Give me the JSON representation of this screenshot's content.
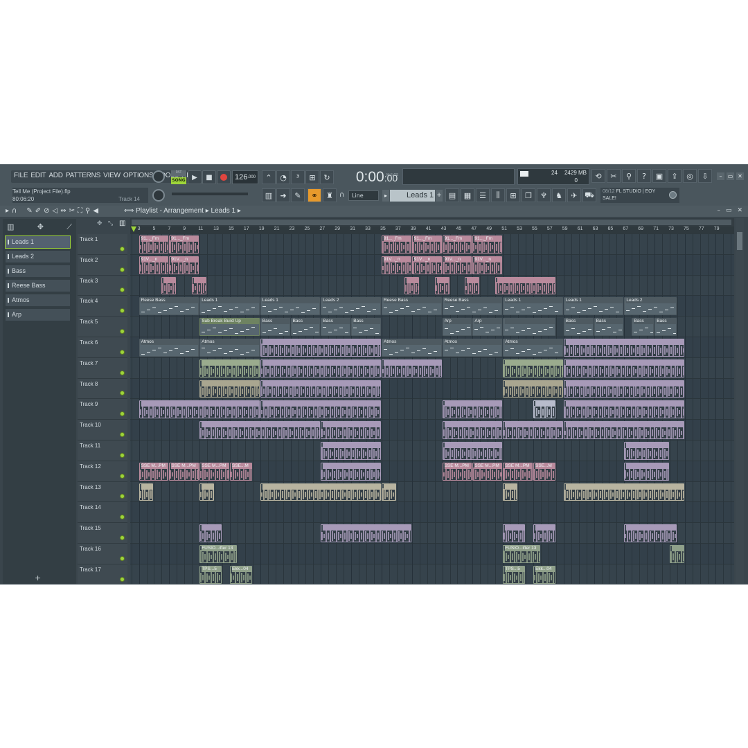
{
  "menu": [
    "FILE",
    "EDIT",
    "ADD",
    "PATTERNS",
    "VIEW",
    "OPTIONS",
    "TOOLS",
    "HELP"
  ],
  "transport": {
    "pat_label": "PAT",
    "song_label": "SONG",
    "tempo": "126",
    "tempo_decimals": ".000",
    "time": "0:00",
    "time_sub": "00",
    "time_unit": "M:S:CS"
  },
  "project": {
    "name": "Tell Me (Project File).flp",
    "time": "80:06:20",
    "track_hint": "Track 14"
  },
  "monitor": {
    "cpu": "24",
    "memory": "2429 MB",
    "polyphony": "0"
  },
  "pattern_selector": "Leads 1",
  "snap": "Line",
  "news": {
    "date": "08/12",
    "text": "FL STUDIO | EOY",
    "text2": "SALE!"
  },
  "playlist": {
    "breadcrumb": "Playlist - Arrangement",
    "pattern": "Leads 1"
  },
  "picker": {
    "items": [
      {
        "label": "Leads 1",
        "selected": true
      },
      {
        "label": "Leads 2"
      },
      {
        "label": "Bass"
      },
      {
        "label": "Reese Bass"
      },
      {
        "label": "Atmos"
      },
      {
        "label": "Arp"
      }
    ],
    "add_label": "+"
  },
  "ruler": {
    "labels": [
      "3",
      "5",
      "7",
      "9",
      "11",
      "13",
      "15",
      "17",
      "19",
      "21",
      "23",
      "25",
      "27",
      "29",
      "31",
      "33",
      "35",
      "37",
      "39",
      "41",
      "43",
      "45",
      "47",
      "49",
      "51",
      "53",
      "55",
      "57",
      "59",
      "61",
      "63",
      "65",
      "67",
      "69",
      "71",
      "73",
      "75",
      "77",
      "79"
    ]
  },
  "tracks": [
    "Track 1",
    "Track 2",
    "Track 3",
    "Track 4",
    "Track 5",
    "Track 6",
    "Track 7",
    "Track 8",
    "Track 9",
    "Track 10",
    "Track 11",
    "Track 12",
    "Track 13",
    "Track 14",
    "Track 15",
    "Track 16",
    "Track 17"
  ],
  "colors": {
    "accent": "#9ed53a",
    "pink": "#b98a9c",
    "mauve": "#a79ab8",
    "sage": "#9aab8e",
    "slate": "#4e5a61",
    "orange": "#e89a2c"
  },
  "clips": [
    {
      "track": 0,
      "start": 3,
      "len": 4,
      "label": "91..._Fm",
      "color": "#b98a9c",
      "kind": "audio"
    },
    {
      "track": 0,
      "start": 7,
      "len": 4,
      "label": "91..._Fm",
      "color": "#b98a9c",
      "kind": "audio"
    },
    {
      "track": 0,
      "start": 35,
      "len": 4,
      "label": "91..._Fm",
      "color": "#b98a9c",
      "kind": "audio"
    },
    {
      "track": 0,
      "start": 39,
      "len": 4,
      "label": "91..._Fm",
      "color": "#b98a9c",
      "kind": "audio"
    },
    {
      "track": 0,
      "start": 43,
      "len": 4,
      "label": "91..._Fm",
      "color": "#b98a9c",
      "kind": "audio"
    },
    {
      "track": 0,
      "start": 47,
      "len": 4,
      "label": "91..._Fm",
      "color": "#b98a9c",
      "kind": "audio"
    },
    {
      "track": 1,
      "start": 3,
      "len": 4,
      "label": "91V..._n",
      "color": "#b98a9c",
      "kind": "audio"
    },
    {
      "track": 1,
      "start": 7,
      "len": 4,
      "label": "91V..._n",
      "color": "#b98a9c",
      "kind": "audio"
    },
    {
      "track": 1,
      "start": 35,
      "len": 4,
      "label": "91V..._n",
      "color": "#b98a9c",
      "kind": "audio"
    },
    {
      "track": 1,
      "start": 39,
      "len": 4,
      "label": "91V..._n",
      "color": "#b98a9c",
      "kind": "audio"
    },
    {
      "track": 1,
      "start": 43,
      "len": 4,
      "label": "91V..._n",
      "color": "#b98a9c",
      "kind": "audio"
    },
    {
      "track": 1,
      "start": 47,
      "len": 4,
      "label": "91V..._n",
      "color": "#b98a9c",
      "kind": "audio"
    },
    {
      "track": 2,
      "start": 6,
      "len": 2,
      "label": "",
      "color": "#b98a9c",
      "kind": "audio"
    },
    {
      "track": 2,
      "start": 10,
      "len": 2,
      "label": "",
      "color": "#b98a9c",
      "kind": "audio"
    },
    {
      "track": 2,
      "start": 38,
      "len": 2,
      "label": "",
      "color": "#b98a9c",
      "kind": "audio"
    },
    {
      "track": 2,
      "start": 42,
      "len": 2,
      "label": "",
      "color": "#b98a9c",
      "kind": "audio"
    },
    {
      "track": 2,
      "start": 46,
      "len": 2,
      "label": "",
      "color": "#b98a9c",
      "kind": "audio"
    },
    {
      "track": 2,
      "start": 50,
      "len": 8,
      "label": "",
      "color": "#b98a9c",
      "kind": "audio"
    },
    {
      "track": 3,
      "start": 3,
      "len": 8,
      "label": "Reese Bass",
      "color": "#4e5a61",
      "kind": "pattern"
    },
    {
      "track": 3,
      "start": 11,
      "len": 8,
      "label": "Leads 1",
      "color": "#4e5a61",
      "kind": "pattern"
    },
    {
      "track": 3,
      "start": 19,
      "len": 8,
      "label": "Leads 1",
      "color": "#4e5a61",
      "kind": "pattern"
    },
    {
      "track": 3,
      "start": 27,
      "len": 8,
      "label": "Leads 2",
      "color": "#4e5a61",
      "kind": "pattern"
    },
    {
      "track": 3,
      "start": 35,
      "len": 8,
      "label": "Reese Bass",
      "color": "#4e5a61",
      "kind": "pattern"
    },
    {
      "track": 3,
      "start": 43,
      "len": 8,
      "label": "Reese Bass",
      "color": "#4e5a61",
      "kind": "pattern"
    },
    {
      "track": 3,
      "start": 51,
      "len": 8,
      "label": "Leads 1",
      "color": "#4e5a61",
      "kind": "pattern"
    },
    {
      "track": 3,
      "start": 59,
      "len": 8,
      "label": "Leads 1",
      "color": "#4e5a61",
      "kind": "pattern"
    },
    {
      "track": 3,
      "start": 67,
      "len": 7,
      "label": "Leads 2",
      "color": "#4e5a61",
      "kind": "pattern"
    },
    {
      "track": 4,
      "start": 11,
      "len": 8,
      "label": "Sub Break Build Up",
      "color": "#6e8361",
      "kind": "pattern"
    },
    {
      "track": 4,
      "start": 19,
      "len": 4,
      "label": "Bass",
      "color": "#4e5a61",
      "kind": "pattern"
    },
    {
      "track": 4,
      "start": 23,
      "len": 4,
      "label": "Bass",
      "color": "#4e5a61",
      "kind": "pattern"
    },
    {
      "track": 4,
      "start": 27,
      "len": 4,
      "label": "Bass",
      "color": "#4e5a61",
      "kind": "pattern"
    },
    {
      "track": 4,
      "start": 31,
      "len": 4,
      "label": "Bass",
      "color": "#4e5a61",
      "kind": "pattern"
    },
    {
      "track": 4,
      "start": 43,
      "len": 4,
      "label": "Arp",
      "color": "#4e5a61",
      "kind": "pattern"
    },
    {
      "track": 4,
      "start": 47,
      "len": 4,
      "label": "Arp",
      "color": "#4e5a61",
      "kind": "pattern"
    },
    {
      "track": 4,
      "start": 51,
      "len": 7,
      "label": "",
      "color": "#4e5a61",
      "kind": "pattern"
    },
    {
      "track": 4,
      "start": 59,
      "len": 4,
      "label": "Bass",
      "color": "#4e5a61",
      "kind": "pattern"
    },
    {
      "track": 4,
      "start": 63,
      "len": 4,
      "label": "Bass",
      "color": "#4e5a61",
      "kind": "pattern"
    },
    {
      "track": 4,
      "start": 68,
      "len": 3,
      "label": "Bass",
      "color": "#4e5a61",
      "kind": "pattern"
    },
    {
      "track": 4,
      "start": 71,
      "len": 3,
      "label": "Bass",
      "color": "#4e5a61",
      "kind": "pattern"
    },
    {
      "track": 5,
      "start": 3,
      "len": 8,
      "label": "Atmos",
      "color": "#4e5a61",
      "kind": "pattern"
    },
    {
      "track": 5,
      "start": 11,
      "len": 8,
      "label": "Atmos",
      "color": "#4e5a61",
      "kind": "pattern"
    },
    {
      "track": 5,
      "start": 19,
      "len": 16,
      "label": "",
      "color": "#a79ab8",
      "kind": "audio"
    },
    {
      "track": 5,
      "start": 35,
      "len": 8,
      "label": "Atmos",
      "color": "#4e5a61",
      "kind": "pattern"
    },
    {
      "track": 5,
      "start": 43,
      "len": 8,
      "label": "Atmos",
      "color": "#4e5a61",
      "kind": "pattern"
    },
    {
      "track": 5,
      "start": 51,
      "len": 8,
      "label": "Atmos",
      "color": "#4e5a61",
      "kind": "pattern"
    },
    {
      "track": 5,
      "start": 59,
      "len": 16,
      "label": "",
      "color": "#a79ab8",
      "kind": "audio"
    },
    {
      "track": 6,
      "start": 11,
      "len": 8,
      "label": "",
      "color": "#9aab8e",
      "kind": "audio"
    },
    {
      "track": 6,
      "start": 19,
      "len": 16,
      "label": "",
      "color": "#a79ab8",
      "kind": "audio"
    },
    {
      "track": 6,
      "start": 35,
      "len": 8,
      "label": "",
      "color": "#a79ab8",
      "kind": "audio"
    },
    {
      "track": 6,
      "start": 51,
      "len": 8,
      "label": "",
      "color": "#9aab8e",
      "kind": "audio"
    },
    {
      "track": 6,
      "start": 59,
      "len": 16,
      "label": "",
      "color": "#a79ab8",
      "kind": "audio"
    },
    {
      "track": 7,
      "start": 11,
      "len": 8,
      "label": "",
      "color": "#a9a690",
      "kind": "audio"
    },
    {
      "track": 7,
      "start": 19,
      "len": 16,
      "label": "",
      "color": "#a79ab8",
      "kind": "audio"
    },
    {
      "track": 7,
      "start": 51,
      "len": 8,
      "label": "",
      "color": "#a9a690",
      "kind": "audio"
    },
    {
      "track": 7,
      "start": 59,
      "len": 16,
      "label": "",
      "color": "#a79ab8",
      "kind": "audio"
    },
    {
      "track": 8,
      "start": 3,
      "len": 16,
      "label": "",
      "color": "#a79ab8",
      "kind": "audio"
    },
    {
      "track": 8,
      "start": 19,
      "len": 16,
      "label": "",
      "color": "#a79ab8",
      "kind": "audio"
    },
    {
      "track": 8,
      "start": 43,
      "len": 8,
      "label": "",
      "color": "#a79ab8",
      "kind": "audio"
    },
    {
      "track": 8,
      "start": 55,
      "len": 3,
      "label": "",
      "color": "#b8bccc",
      "kind": "audio"
    },
    {
      "track": 8,
      "start": 59,
      "len": 16,
      "label": "",
      "color": "#a79ab8",
      "kind": "audio"
    },
    {
      "track": 9,
      "start": 11,
      "len": 16,
      "label": "",
      "color": "#a79ab8",
      "kind": "audio"
    },
    {
      "track": 9,
      "start": 27,
      "len": 8,
      "label": "",
      "color": "#a79ab8",
      "kind": "audio"
    },
    {
      "track": 9,
      "start": 43,
      "len": 8,
      "label": "",
      "color": "#a79ab8",
      "kind": "audio"
    },
    {
      "track": 9,
      "start": 51,
      "len": 8,
      "label": "",
      "color": "#a79ab8",
      "kind": "audio"
    },
    {
      "track": 9,
      "start": 59,
      "len": 16,
      "label": "",
      "color": "#a79ab8",
      "kind": "audio"
    },
    {
      "track": 10,
      "start": 27,
      "len": 8,
      "label": "",
      "color": "#a79ab8",
      "kind": "audio"
    },
    {
      "track": 10,
      "start": 43,
      "len": 8,
      "label": "",
      "color": "#a79ab8",
      "kind": "audio"
    },
    {
      "track": 10,
      "start": 67,
      "len": 6,
      "label": "",
      "color": "#a79ab8",
      "kind": "audio"
    },
    {
      "track": 11,
      "start": 3,
      "len": 4,
      "label": "SSE M...PM",
      "color": "#b98a9c",
      "kind": "audio"
    },
    {
      "track": 11,
      "start": 7,
      "len": 4,
      "label": "SSE M...PM",
      "color": "#b98a9c",
      "kind": "audio"
    },
    {
      "track": 11,
      "start": 11,
      "len": 4,
      "label": "SSE M...PM",
      "color": "#b98a9c",
      "kind": "audio"
    },
    {
      "track": 11,
      "start": 15,
      "len": 3,
      "label": "SSE...M",
      "color": "#b98a9c",
      "kind": "audio"
    },
    {
      "track": 11,
      "start": 43,
      "len": 4,
      "label": "SSE M...PM",
      "color": "#b98a9c",
      "kind": "audio"
    },
    {
      "track": 11,
      "start": 47,
      "len": 4,
      "label": "SSE M...PM",
      "color": "#b98a9c",
      "kind": "audio"
    },
    {
      "track": 11,
      "start": 51,
      "len": 4,
      "label": "SSE M...PM",
      "color": "#b98a9c",
      "kind": "audio"
    },
    {
      "track": 11,
      "start": 55,
      "len": 3,
      "label": "SSE...M",
      "color": "#b98a9c",
      "kind": "audio"
    },
    {
      "track": 11,
      "start": 27,
      "len": 8,
      "label": "",
      "color": "#a79ab8",
      "kind": "audio"
    },
    {
      "track": 11,
      "start": 67,
      "len": 6,
      "label": "",
      "color": "#a79ab8",
      "kind": "audio"
    },
    {
      "track": 12,
      "start": 3,
      "len": 2,
      "label": "",
      "color": "#b8b4a0",
      "kind": "audio"
    },
    {
      "track": 12,
      "start": 11,
      "len": 2,
      "label": "",
      "color": "#b8b4a0",
      "kind": "audio"
    },
    {
      "track": 12,
      "start": 19,
      "len": 16,
      "label": "",
      "color": "#b8b4a0",
      "kind": "audio"
    },
    {
      "track": 12,
      "start": 35,
      "len": 2,
      "label": "",
      "color": "#b8b4a0",
      "kind": "audio"
    },
    {
      "track": 12,
      "start": 51,
      "len": 2,
      "label": "",
      "color": "#b8b4a0",
      "kind": "audio"
    },
    {
      "track": 12,
      "start": 59,
      "len": 16,
      "label": "",
      "color": "#b8b4a0",
      "kind": "audio"
    },
    {
      "track": 14,
      "start": 11,
      "len": 3,
      "label": "",
      "color": "#a79ab8",
      "kind": "audio"
    },
    {
      "track": 14,
      "start": 27,
      "len": 12,
      "label": "",
      "color": "#a79ab8",
      "kind": "audio"
    },
    {
      "track": 14,
      "start": 51,
      "len": 3,
      "label": "",
      "color": "#a79ab8",
      "kind": "audio"
    },
    {
      "track": 14,
      "start": 55,
      "len": 3,
      "label": "",
      "color": "#a79ab8",
      "kind": "audio"
    },
    {
      "track": 14,
      "start": 67,
      "len": 7,
      "label": "",
      "color": "#a79ab8",
      "kind": "audio"
    },
    {
      "track": 15,
      "start": 11,
      "len": 5,
      "label": "FUSIO...ifter 13",
      "color": "#8fa08a",
      "kind": "audio"
    },
    {
      "track": 15,
      "start": 51,
      "len": 5,
      "label": "FUSIO...ifter 13",
      "color": "#8fa08a",
      "kind": "audio"
    },
    {
      "track": 15,
      "start": 73,
      "len": 2,
      "label": "",
      "color": "#8fa08a",
      "kind": "audio"
    },
    {
      "track": 16,
      "start": 11,
      "len": 3,
      "label": "TPS...5",
      "color": "#8fa08a",
      "kind": "audio"
    },
    {
      "track": 16,
      "start": 15,
      "len": 3,
      "label": "Ekk...04",
      "color": "#8fa08a",
      "kind": "audio"
    },
    {
      "track": 16,
      "start": 51,
      "len": 3,
      "label": "TPS...5",
      "color": "#8fa08a",
      "kind": "audio"
    },
    {
      "track": 16,
      "start": 55,
      "len": 3,
      "label": "Ekk...04",
      "color": "#8fa08a",
      "kind": "audio"
    }
  ]
}
